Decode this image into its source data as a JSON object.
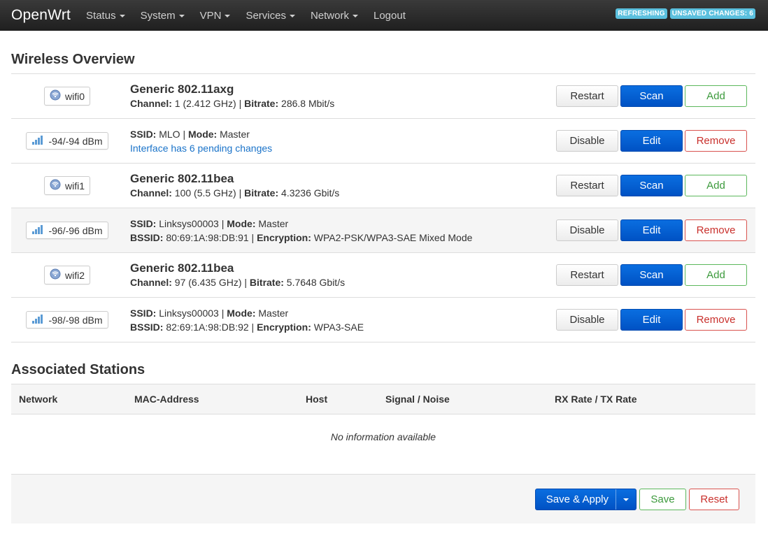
{
  "nav": {
    "brand": "OpenWrt",
    "menu": [
      {
        "label": "Status",
        "dropdown": true
      },
      {
        "label": "System",
        "dropdown": true
      },
      {
        "label": "VPN",
        "dropdown": true
      },
      {
        "label": "Services",
        "dropdown": true
      },
      {
        "label": "Network",
        "dropdown": true
      },
      {
        "label": "Logout",
        "dropdown": false
      }
    ],
    "badges": [
      "REFRESHING",
      "UNSAVED CHANGES: 6"
    ]
  },
  "wireless": {
    "title": "Wireless Overview",
    "rows": [
      {
        "type": "device",
        "badge": "wifi0",
        "icon": "wifi-device-icon",
        "title": "Generic 802.11axg",
        "line2": [
          {
            "k": "Channel:",
            "v": " 1 (2.412 GHz) | "
          },
          {
            "k": "Bitrate:",
            "v": " 286.8 Mbit/s"
          }
        ],
        "buttons": [
          "Restart",
          "Scan",
          "Add"
        ]
      },
      {
        "type": "iface",
        "badge": "-94/-94 dBm",
        "icon": "signal-strength-icon",
        "line1": [
          {
            "k": "SSID:",
            "v": " MLO | "
          },
          {
            "k": "Mode:",
            "v": " Master"
          }
        ],
        "note": "Interface has 6 pending changes",
        "buttons": [
          "Disable",
          "Edit",
          "Remove"
        ]
      },
      {
        "type": "device",
        "badge": "wifi1",
        "icon": "wifi-device-icon",
        "title": "Generic 802.11bea",
        "line2": [
          {
            "k": "Channel:",
            "v": " 100 (5.5 GHz) | "
          },
          {
            "k": "Bitrate:",
            "v": " 4.3236 Gbit/s"
          }
        ],
        "buttons": [
          "Restart",
          "Scan",
          "Add"
        ]
      },
      {
        "type": "iface",
        "badge": "-96/-96 dBm",
        "icon": "signal-strength-icon",
        "line1": [
          {
            "k": "SSID:",
            "v": " Linksys00003 | "
          },
          {
            "k": "Mode:",
            "v": " Master"
          }
        ],
        "line2": [
          {
            "k": "BSSID:",
            "v": " 80:69:1A:98:DB:91 | "
          },
          {
            "k": "Encryption:",
            "v": " WPA2-PSK/WPA3-SAE Mixed Mode"
          }
        ],
        "buttons": [
          "Disable",
          "Edit",
          "Remove"
        ]
      },
      {
        "type": "device",
        "badge": "wifi2",
        "icon": "wifi-device-icon",
        "title": "Generic 802.11bea",
        "line2": [
          {
            "k": "Channel:",
            "v": " 97 (6.435 GHz) | "
          },
          {
            "k": "Bitrate:",
            "v": " 5.7648 Gbit/s"
          }
        ],
        "buttons": [
          "Restart",
          "Scan",
          "Add"
        ]
      },
      {
        "type": "iface",
        "badge": "-98/-98 dBm",
        "icon": "signal-strength-icon",
        "line1": [
          {
            "k": "SSID:",
            "v": " Linksys00003 | "
          },
          {
            "k": "Mode:",
            "v": " Master"
          }
        ],
        "line2": [
          {
            "k": "BSSID:",
            "v": " 82:69:1A:98:DB:92 | "
          },
          {
            "k": "Encryption:",
            "v": " WPA3-SAE"
          }
        ],
        "buttons": [
          "Disable",
          "Edit",
          "Remove"
        ]
      }
    ]
  },
  "stations": {
    "title": "Associated Stations",
    "columns": [
      "Network",
      "MAC-Address",
      "Host",
      "Signal / Noise",
      "RX Rate / TX Rate"
    ],
    "empty": "No information available"
  },
  "footer": {
    "save_apply": "Save & Apply",
    "save": "Save",
    "reset": "Reset"
  },
  "colors": {
    "primary": "#0052c4",
    "success": "#5cb85c",
    "danger": "#d9534f",
    "badge": "#5bc0de",
    "link": "#1a73c9"
  }
}
